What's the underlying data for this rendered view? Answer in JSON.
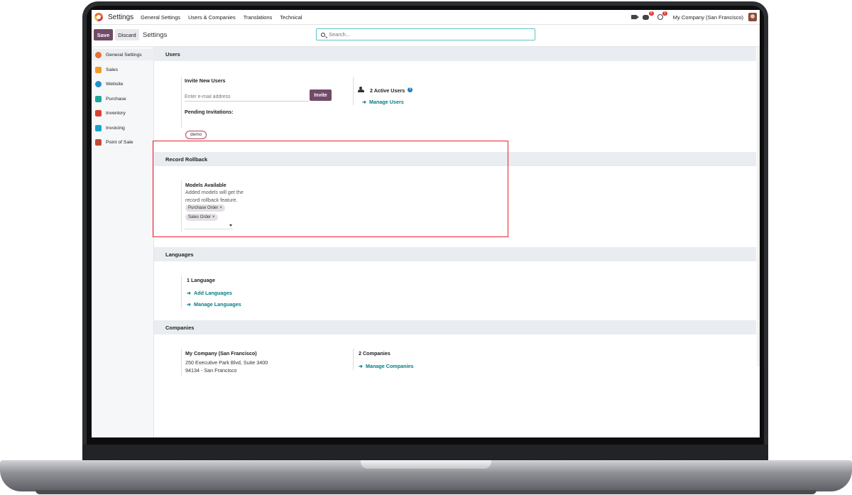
{
  "navbar": {
    "app_name": "Settings",
    "menu": [
      "General Settings",
      "Users & Companies",
      "Translations",
      "Technical"
    ],
    "chat_badge": "5",
    "activity_badge": "5",
    "company": "My Company (San Francisco)"
  },
  "control_panel": {
    "save_label": "Save",
    "discard_label": "Discard",
    "title": "Settings",
    "search_placeholder": "Search..."
  },
  "sidebar": {
    "items": [
      {
        "label": "General Settings",
        "icon": "general-settings-icon",
        "color": "#e46e35"
      },
      {
        "label": "Sales",
        "icon": "sales-icon",
        "color": "#f29b2c"
      },
      {
        "label": "Website",
        "icon": "website-icon",
        "color": "#1f8fc9"
      },
      {
        "label": "Purchase",
        "icon": "purchase-icon",
        "color": "#20a59a"
      },
      {
        "label": "Inventory",
        "icon": "inventory-icon",
        "color": "#d9412f"
      },
      {
        "label": "Invoicing",
        "icon": "invoicing-icon",
        "color": "#1aa3c6"
      },
      {
        "label": "Point of Sale",
        "icon": "point-of-sale-icon",
        "color": "#c24a36"
      }
    ]
  },
  "users": {
    "section_title": "Users",
    "invite_title": "Invite New Users",
    "email_placeholder": "Enter e-mail address",
    "invite_label": "Invite",
    "pending_title": "Pending Invitations:",
    "pending_tag": "demo",
    "active_users": "2 Active Users",
    "help_glyph": "?",
    "manage_users": "Manage Users"
  },
  "record_rollback": {
    "section_title": "Record Rollback",
    "models_title": "Models Available",
    "description_line1": "Added models will get the",
    "description_line2": "record rollback feature.",
    "tags": [
      "Purchase Order",
      "Sales Order"
    ],
    "remove_glyph": "×"
  },
  "languages": {
    "section_title": "Languages",
    "count": "1 Language",
    "add_link": "Add Languages",
    "manage_link": "Manage Languages"
  },
  "companies": {
    "section_title": "Companies",
    "company_name": "My Company (San Francisco)",
    "address_line1": "250 Executive Park Blvd, Suite 3400",
    "address_line2": "94134 - San Francisco",
    "count": "2 Companies",
    "manage_link": "Manage Companies"
  },
  "arrow_glyph": "➔",
  "colors": {
    "brand": "#714b67",
    "link": "#017e84",
    "highlight": "#e8212a"
  }
}
